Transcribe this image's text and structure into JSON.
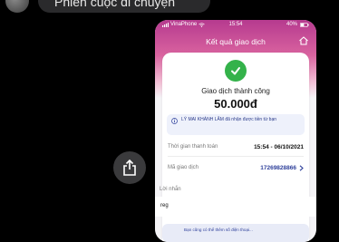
{
  "chat": {
    "message_partial": "Phiên cuộc di chuyện"
  },
  "status_bar": {
    "carrier": "VinaPhone",
    "time": "15:54",
    "battery": "40%"
  },
  "screen": {
    "title": "Kết quả giao dịch"
  },
  "receipt": {
    "status": "Giao dịch thành công",
    "amount": "50.000đ",
    "info_message": "LÝ MAI KHÁNH LÂM đã nhận được tiền từ bạn",
    "time_label": "Thời gian thanh toán",
    "time_value": "15:54 - 06/10/2021",
    "code_label": "Mã giao dịch",
    "code_value": "17269828866"
  },
  "note": {
    "label": "Lời nhắn",
    "value": "reg"
  },
  "banner": {
    "text": "Bạn cũng có thể thêm số điện thoại..."
  },
  "colors": {
    "header_top": "#b63a8f",
    "success_green": "#34b24a",
    "link_blue": "#2d3f9a"
  },
  "icons": [
    "share-icon",
    "home-icon",
    "check-icon",
    "info-icon",
    "chevron-right-icon",
    "wifi-icon",
    "signal-icon",
    "battery-icon"
  ]
}
